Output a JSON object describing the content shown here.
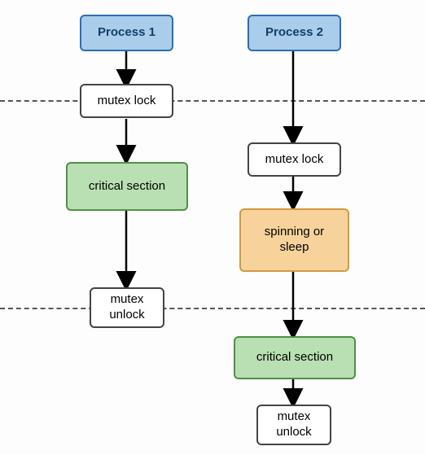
{
  "diagram": {
    "process1": {
      "title": "Process 1",
      "lock": "mutex lock",
      "critical": "critical section",
      "unlock": "mutex\nunlock"
    },
    "process2": {
      "title": "Process 2",
      "lock": "mutex lock",
      "spin": "spinning or\nsleep",
      "critical": "critical section",
      "unlock": "mutex\nunlock"
    }
  }
}
